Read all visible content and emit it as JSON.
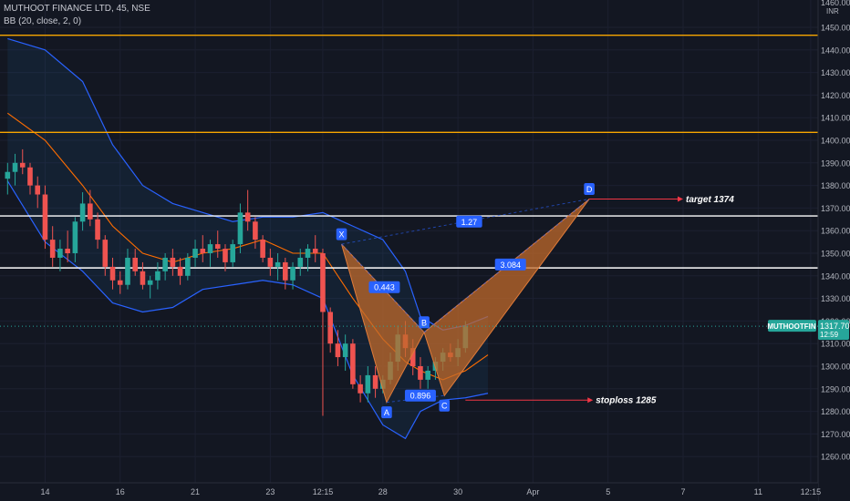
{
  "legend": {
    "symbol_line": "MUTHOOT FINANCE LTD, 45, NSE",
    "indicator_line": "BB (20, close, 2, 0)"
  },
  "price_scale": {
    "currency": "INR",
    "top_label": "1460.00"
  },
  "price_tag": {
    "symbol": "MUTHOOTFIN",
    "price": "1317.70",
    "countdown": "12:59"
  },
  "colors": {
    "background": "#131722",
    "up_candle": "#26a69a",
    "down_candle": "#ef5350",
    "bb_band": "#2962ff",
    "bb_basis": "#ff6d00",
    "orange_level": "#f7a600",
    "white_level": "#ffffff",
    "pattern_fill": "#c0692b",
    "label_box": "#2962ff",
    "price_tag": "#26a69a"
  },
  "chart_data": {
    "type": "candlestick",
    "title": "MUTHOOT FINANCE LTD, 45, NSE",
    "ylim": [
      1253,
      1458
    ],
    "y_ticks": [
      1260,
      1270,
      1280,
      1290,
      1300,
      1310,
      1320,
      1330,
      1340,
      1350,
      1360,
      1370,
      1380,
      1390,
      1400,
      1410,
      1420,
      1430,
      1440,
      1450
    ],
    "x_tick_labels": [
      {
        "label": "14",
        "bar": 5
      },
      {
        "label": "16",
        "bar": 15
      },
      {
        "label": "21",
        "bar": 25
      },
      {
        "label": "23",
        "bar": 35
      },
      {
        "label": "12:15",
        "bar": 42
      },
      {
        "label": "28",
        "bar": 50
      },
      {
        "label": "30",
        "bar": 60
      },
      {
        "label": "Apr",
        "bar": 70
      },
      {
        "label": "5",
        "bar": 80
      },
      {
        "label": "7",
        "bar": 90
      },
      {
        "label": "11",
        "bar": 100
      },
      {
        "label": "12:15",
        "bar": 107
      }
    ],
    "x_range": [
      0,
      112
    ],
    "candles": [
      {
        "o": 1383,
        "h": 1390,
        "l": 1376,
        "c": 1386
      },
      {
        "o": 1386,
        "h": 1394,
        "l": 1380,
        "c": 1390
      },
      {
        "o": 1390,
        "h": 1396,
        "l": 1385,
        "c": 1388
      },
      {
        "o": 1388,
        "h": 1390,
        "l": 1376,
        "c": 1380
      },
      {
        "o": 1380,
        "h": 1384,
        "l": 1370,
        "c": 1376
      },
      {
        "o": 1376,
        "h": 1380,
        "l": 1352,
        "c": 1356
      },
      {
        "o": 1356,
        "h": 1362,
        "l": 1344,
        "c": 1348
      },
      {
        "o": 1348,
        "h": 1356,
        "l": 1342,
        "c": 1352
      },
      {
        "o": 1352,
        "h": 1360,
        "l": 1346,
        "c": 1350
      },
      {
        "o": 1350,
        "h": 1366,
        "l": 1346,
        "c": 1364
      },
      {
        "o": 1364,
        "h": 1377,
        "l": 1360,
        "c": 1372
      },
      {
        "o": 1372,
        "h": 1378,
        "l": 1362,
        "c": 1365
      },
      {
        "o": 1365,
        "h": 1368,
        "l": 1352,
        "c": 1356
      },
      {
        "o": 1356,
        "h": 1358,
        "l": 1340,
        "c": 1344
      },
      {
        "o": 1344,
        "h": 1348,
        "l": 1334,
        "c": 1338
      },
      {
        "o": 1338,
        "h": 1342,
        "l": 1332,
        "c": 1336
      },
      {
        "o": 1336,
        "h": 1352,
        "l": 1334,
        "c": 1348
      },
      {
        "o": 1348,
        "h": 1352,
        "l": 1340,
        "c": 1342
      },
      {
        "o": 1342,
        "h": 1346,
        "l": 1334,
        "c": 1336
      },
      {
        "o": 1336,
        "h": 1340,
        "l": 1330,
        "c": 1338
      },
      {
        "o": 1338,
        "h": 1346,
        "l": 1334,
        "c": 1342
      },
      {
        "o": 1342,
        "h": 1350,
        "l": 1338,
        "c": 1348
      },
      {
        "o": 1348,
        "h": 1352,
        "l": 1340,
        "c": 1344
      },
      {
        "o": 1344,
        "h": 1348,
        "l": 1336,
        "c": 1340
      },
      {
        "o": 1340,
        "h": 1350,
        "l": 1338,
        "c": 1348
      },
      {
        "o": 1348,
        "h": 1356,
        "l": 1344,
        "c": 1352
      },
      {
        "o": 1352,
        "h": 1358,
        "l": 1346,
        "c": 1350
      },
      {
        "o": 1350,
        "h": 1356,
        "l": 1344,
        "c": 1354
      },
      {
        "o": 1354,
        "h": 1360,
        "l": 1348,
        "c": 1352
      },
      {
        "o": 1352,
        "h": 1354,
        "l": 1342,
        "c": 1346
      },
      {
        "o": 1346,
        "h": 1356,
        "l": 1344,
        "c": 1354
      },
      {
        "o": 1354,
        "h": 1372,
        "l": 1350,
        "c": 1368
      },
      {
        "o": 1368,
        "h": 1378,
        "l": 1360,
        "c": 1364
      },
      {
        "o": 1364,
        "h": 1366,
        "l": 1352,
        "c": 1356
      },
      {
        "o": 1356,
        "h": 1358,
        "l": 1346,
        "c": 1348
      },
      {
        "o": 1348,
        "h": 1352,
        "l": 1340,
        "c": 1344
      },
      {
        "o": 1344,
        "h": 1350,
        "l": 1338,
        "c": 1346
      },
      {
        "o": 1346,
        "h": 1348,
        "l": 1334,
        "c": 1338
      },
      {
        "o": 1338,
        "h": 1346,
        "l": 1334,
        "c": 1344
      },
      {
        "o": 1344,
        "h": 1352,
        "l": 1340,
        "c": 1348
      },
      {
        "o": 1348,
        "h": 1354,
        "l": 1342,
        "c": 1352
      },
      {
        "o": 1352,
        "h": 1358,
        "l": 1346,
        "c": 1350
      },
      {
        "o": 1350,
        "h": 1352,
        "l": 1278,
        "c": 1324
      },
      {
        "o": 1324,
        "h": 1326,
        "l": 1306,
        "c": 1310
      },
      {
        "o": 1310,
        "h": 1316,
        "l": 1300,
        "c": 1304
      },
      {
        "o": 1304,
        "h": 1314,
        "l": 1298,
        "c": 1310
      },
      {
        "o": 1310,
        "h": 1312,
        "l": 1290,
        "c": 1292
      },
      {
        "o": 1292,
        "h": 1296,
        "l": 1284,
        "c": 1288
      },
      {
        "o": 1288,
        "h": 1300,
        "l": 1284,
        "c": 1296
      },
      {
        "o": 1296,
        "h": 1300,
        "l": 1286,
        "c": 1290
      },
      {
        "o": 1290,
        "h": 1296,
        "l": 1288,
        "c": 1294
      },
      {
        "o": 1294,
        "h": 1306,
        "l": 1292,
        "c": 1302
      },
      {
        "o": 1302,
        "h": 1318,
        "l": 1298,
        "c": 1314
      },
      {
        "o": 1314,
        "h": 1320,
        "l": 1304,
        "c": 1308
      },
      {
        "o": 1308,
        "h": 1312,
        "l": 1296,
        "c": 1300
      },
      {
        "o": 1300,
        "h": 1304,
        "l": 1290,
        "c": 1294
      },
      {
        "o": 1294,
        "h": 1300,
        "l": 1290,
        "c": 1298
      },
      {
        "o": 1298,
        "h": 1304,
        "l": 1294,
        "c": 1302
      },
      {
        "o": 1302,
        "h": 1308,
        "l": 1298,
        "c": 1306
      },
      {
        "o": 1306,
        "h": 1310,
        "l": 1302,
        "c": 1304
      },
      {
        "o": 1304,
        "h": 1312,
        "l": 1300,
        "c": 1308
      },
      {
        "o": 1308,
        "h": 1320,
        "l": 1306,
        "c": 1317.7
      }
    ],
    "bollinger": {
      "name": "BB (20, close, 2, 0)",
      "upper": [
        {
          "x": 0,
          "y": 1445
        },
        {
          "x": 5,
          "y": 1440
        },
        {
          "x": 10,
          "y": 1426
        },
        {
          "x": 14,
          "y": 1398
        },
        {
          "x": 18,
          "y": 1380
        },
        {
          "x": 22,
          "y": 1372
        },
        {
          "x": 26,
          "y": 1368
        },
        {
          "x": 30,
          "y": 1364
        },
        {
          "x": 34,
          "y": 1366
        },
        {
          "x": 38,
          "y": 1366
        },
        {
          "x": 42,
          "y": 1368
        },
        {
          "x": 46,
          "y": 1362
        },
        {
          "x": 50,
          "y": 1356
        },
        {
          "x": 53,
          "y": 1342
        },
        {
          "x": 55,
          "y": 1322
        },
        {
          "x": 58,
          "y": 1316
        },
        {
          "x": 61,
          "y": 1318
        },
        {
          "x": 64,
          "y": 1322
        }
      ],
      "lower": [
        {
          "x": 0,
          "y": 1382
        },
        {
          "x": 5,
          "y": 1355
        },
        {
          "x": 10,
          "y": 1342
        },
        {
          "x": 14,
          "y": 1328
        },
        {
          "x": 18,
          "y": 1324
        },
        {
          "x": 22,
          "y": 1326
        },
        {
          "x": 26,
          "y": 1334
        },
        {
          "x": 30,
          "y": 1336
        },
        {
          "x": 34,
          "y": 1338
        },
        {
          "x": 38,
          "y": 1336
        },
        {
          "x": 42,
          "y": 1330
        },
        {
          "x": 46,
          "y": 1296
        },
        {
          "x": 50,
          "y": 1274
        },
        {
          "x": 53,
          "y": 1268
        },
        {
          "x": 55,
          "y": 1280
        },
        {
          "x": 58,
          "y": 1285
        },
        {
          "x": 61,
          "y": 1286
        },
        {
          "x": 64,
          "y": 1288
        }
      ],
      "basis": [
        {
          "x": 0,
          "y": 1412
        },
        {
          "x": 5,
          "y": 1400
        },
        {
          "x": 10,
          "y": 1380
        },
        {
          "x": 14,
          "y": 1362
        },
        {
          "x": 18,
          "y": 1350
        },
        {
          "x": 22,
          "y": 1346
        },
        {
          "x": 26,
          "y": 1350
        },
        {
          "x": 30,
          "y": 1352
        },
        {
          "x": 34,
          "y": 1356
        },
        {
          "x": 38,
          "y": 1350
        },
        {
          "x": 42,
          "y": 1350
        },
        {
          "x": 46,
          "y": 1330
        },
        {
          "x": 50,
          "y": 1312
        },
        {
          "x": 53,
          "y": 1302
        },
        {
          "x": 55,
          "y": 1298
        },
        {
          "x": 58,
          "y": 1294
        },
        {
          "x": 61,
          "y": 1298
        },
        {
          "x": 64,
          "y": 1305
        }
      ]
    },
    "levels": [
      {
        "price": 1446.5,
        "color": "#f7a600"
      },
      {
        "price": 1403.5,
        "color": "#f7a600"
      },
      {
        "price": 1366.5,
        "color": "#ffffff"
      },
      {
        "price": 1343.5,
        "color": "#ffffff"
      }
    ],
    "pattern": {
      "points": [
        {
          "label": "X",
          "x": 44.5,
          "y": 1354
        },
        {
          "label": "A",
          "x": 50.5,
          "y": 1284
        },
        {
          "label": "B",
          "x": 55.5,
          "y": 1315
        },
        {
          "label": "C",
          "x": 58.2,
          "y": 1287
        },
        {
          "label": "D",
          "x": 77.5,
          "y": 1374
        }
      ],
      "ratios": [
        {
          "label": "0.443",
          "x": 50.2,
          "y": 1335
        },
        {
          "label": "0.896",
          "x": 55,
          "y": 1287
        },
        {
          "label": "1.27",
          "x": 61.5,
          "y": 1364
        },
        {
          "label": "3.084",
          "x": 67,
          "y": 1345
        }
      ]
    },
    "annotations": [
      {
        "text": "target 1374",
        "from_x": 77.5,
        "to_x": 90,
        "y": 1374
      },
      {
        "text": "stoploss 1285",
        "from_x": 61,
        "to_x": 78,
        "y": 1285
      }
    ]
  }
}
